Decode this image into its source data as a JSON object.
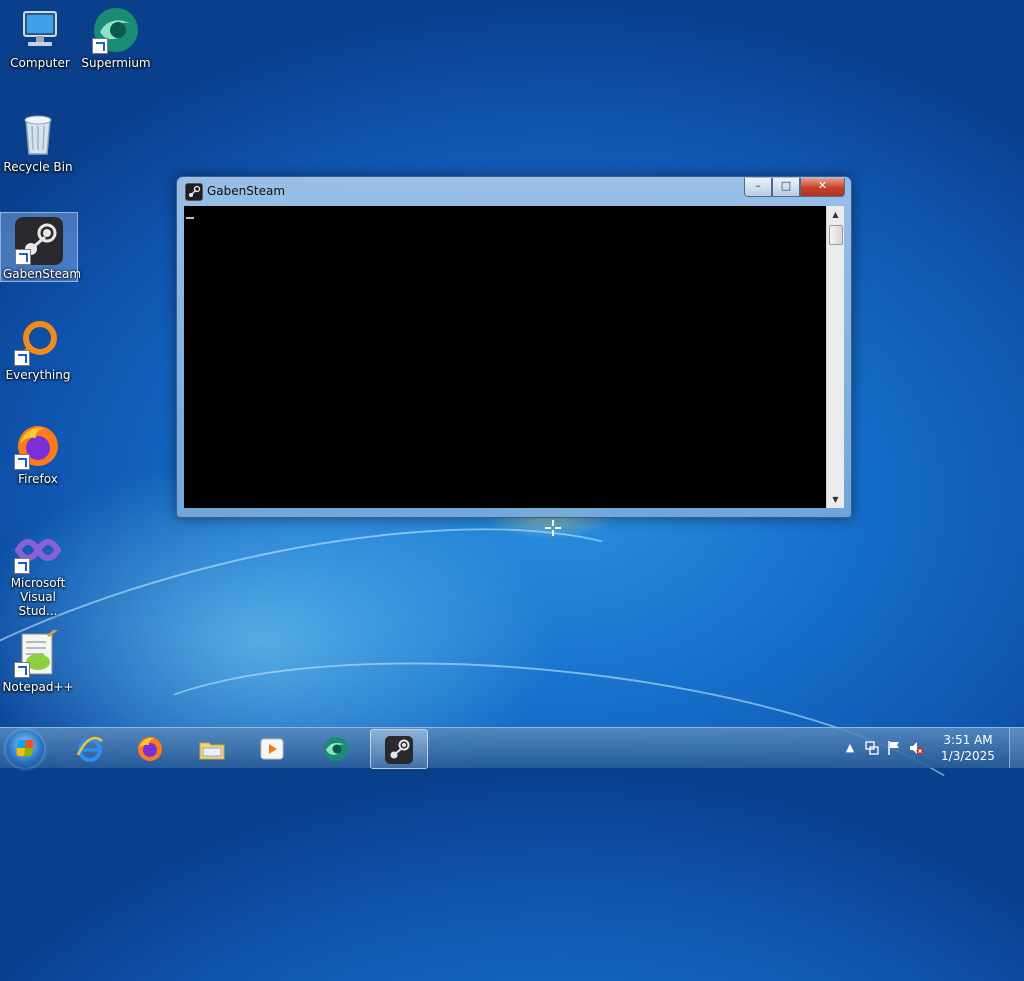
{
  "desktop": {
    "icons": [
      {
        "label": "Computer",
        "icon": "computer-icon"
      },
      {
        "label": "Supermium",
        "icon": "supermium-icon"
      },
      {
        "label": "Recycle Bin",
        "icon": "recycle-bin-icon"
      },
      {
        "label": "GabenSteam",
        "icon": "steam-icon"
      },
      {
        "label": "Everything",
        "icon": "everything-icon"
      },
      {
        "label": "Firefox",
        "icon": "firefox-icon"
      },
      {
        "label": "Microsoft Visual Stud...",
        "icon": "visual-studio-icon"
      },
      {
        "label": "Notepad++",
        "icon": "notepadpp-icon"
      }
    ]
  },
  "window": {
    "title": "GabenSteam",
    "minimize_symbol": "–",
    "maximize_symbol": "□",
    "close_symbol": "✕"
  },
  "taskbar": {
    "pinned": [
      {
        "name": "internet-explorer",
        "icon": "ie-icon"
      },
      {
        "name": "firefox",
        "icon": "firefox-icon"
      },
      {
        "name": "file-explorer",
        "icon": "folder-icon"
      },
      {
        "name": "media-player",
        "icon": "media-player-icon"
      },
      {
        "name": "supermium",
        "icon": "supermium-icon"
      },
      {
        "name": "gabensteam",
        "icon": "steam-icon"
      }
    ],
    "tray": {
      "show_hidden_symbol": "▲",
      "time": "3:51 AM",
      "date": "1/3/2025"
    }
  },
  "colors": {
    "console_bg": "#000000",
    "desktop_blue": "#1670cc",
    "close_red": "#c8412a"
  }
}
